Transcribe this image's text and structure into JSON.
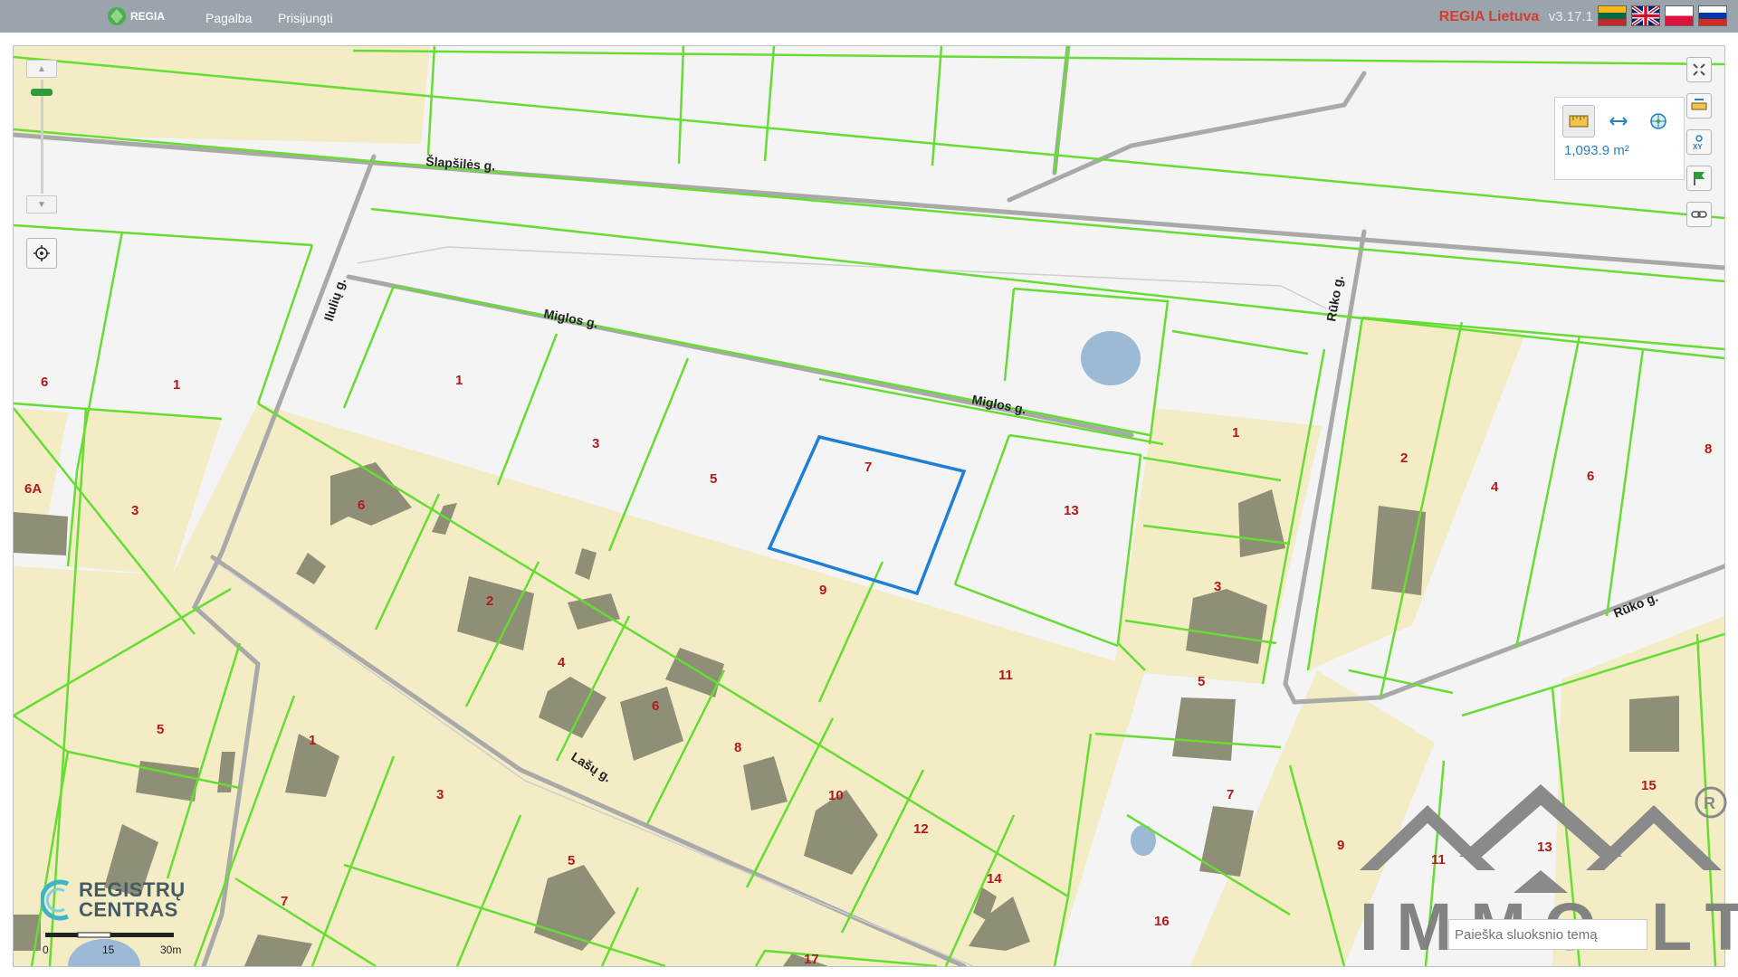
{
  "header": {
    "logo_text": "REGIA",
    "nav": [
      "Pagalba",
      "Prisijungti"
    ],
    "brand_name": "REGIA Lietuva",
    "version": "v3.17.1",
    "languages": [
      "lt-flag-icon",
      "uk-flag-icon",
      "pl-flag-icon",
      "ru-flag-icon"
    ]
  },
  "map": {
    "streets": [
      "Šlapšilės g.",
      "Miglos g.",
      "Miglos g.",
      "Rūko g.",
      "Rūko g.",
      "Lašų g.",
      "Ilulių g."
    ],
    "parcel_labels": [
      "1",
      "3",
      "5",
      "7",
      "9",
      "11",
      "13",
      "6",
      "1",
      "6",
      "6A",
      "3",
      "2",
      "4",
      "6",
      "8",
      "10",
      "12",
      "14",
      "16",
      "17",
      "1",
      "3",
      "5",
      "7",
      "9",
      "11",
      "13",
      "15",
      "2",
      "4",
      "6",
      "8",
      "1",
      "3",
      "5",
      "7",
      "5"
    ],
    "selected_parcel": "7",
    "selection_color": "#1f7fd6",
    "parcel_line_color": "#66dd33",
    "built_area_color": "#f3ecc4"
  },
  "measure": {
    "area_value": "1,093.9 m²"
  },
  "scale": {
    "ticks": [
      "0",
      "15",
      "30m"
    ]
  },
  "branding": {
    "registry_line1": "REGISTRŲ",
    "registry_line2": "CENTRAS",
    "watermark": "IMMO.LT"
  },
  "layer_search": {
    "placeholder": "Paieška sluoksnio temą"
  }
}
